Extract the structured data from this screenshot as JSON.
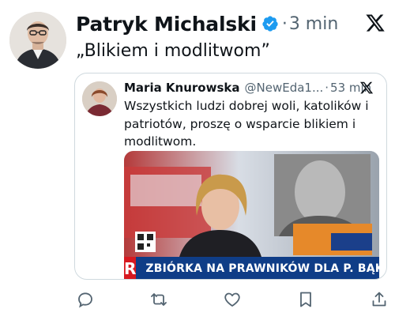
{
  "tweet": {
    "author_name": "Patryk Michalski",
    "dot": "·",
    "time": "3 min",
    "text": "„Blikiem i modlitwom”"
  },
  "quote": {
    "author_name": "Maria Knurowska",
    "handle": "@NewEda1...",
    "dot": "·",
    "time": "53 min",
    "text": "Wszystkich ludzi dobrej woli, katolików i patriotów, proszę o wsparcie blikiem i modlitwom.",
    "media": {
      "ticker_logo": "R",
      "ticker_text": "ZBIÓRKA NA PRAWNIKÓW DLA P. BĄKIEWICZA"
    }
  },
  "colors": {
    "text": "#0f1419",
    "secondary": "#536471",
    "verified_blue": "#1d9bf0",
    "border": "#cfd9de",
    "ticker_bg": "#0f3d87",
    "ticker_logo_bg": "#d71920"
  },
  "icons": {
    "verified": "verified-badge-icon",
    "platform": "x-logo-icon",
    "actions": [
      "reply-icon",
      "retweet-icon",
      "like-icon",
      "bookmark-icon",
      "share-icon"
    ]
  }
}
